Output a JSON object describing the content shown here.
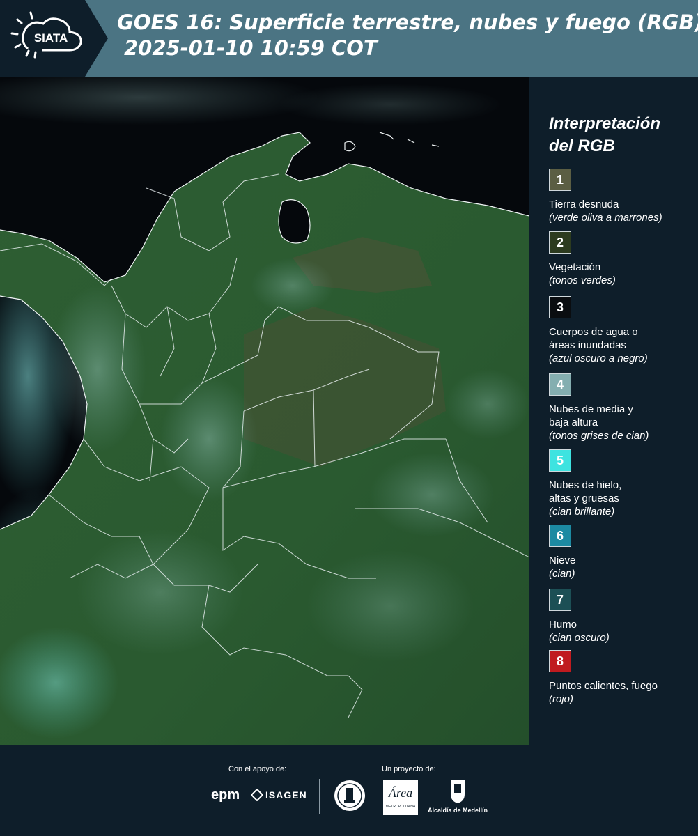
{
  "header": {
    "logo_text": "SIATA",
    "title_line1": "GOES 16: Superficie terrestre, nubes y fuego (RGB)",
    "title_line2": "2025-01-10 10:59 COT"
  },
  "legend": {
    "title": "Interpretación del RGB",
    "items": [
      {
        "number": "1",
        "color": "#5b5e43",
        "label": "Tierra desnuda",
        "note": "(verde oliva a marrones)"
      },
      {
        "number": "2",
        "color": "#2c3b1f",
        "label": "Vegetación",
        "note": "(tonos verdes)"
      },
      {
        "number": "3",
        "color": "#0a0d10",
        "label": "Cuerpos de agua o áreas inundadas",
        "note": "(azul oscuro a negro)"
      },
      {
        "number": "4",
        "color": "#84aeb0",
        "label": "Nubes de media y baja altura",
        "note": "(tonos grises de cian)"
      },
      {
        "number": "5",
        "color": "#3ee3e0",
        "label": "Nubes de hielo, altas y gruesas",
        "note": "(cian brillante)"
      },
      {
        "number": "6",
        "color": "#1c8aa2",
        "label": "Nieve",
        "note": "(cian)"
      },
      {
        "number": "7",
        "color": "#1c4f55",
        "label": "Humo",
        "note": "(cian oscuro)"
      },
      {
        "number": "8",
        "color": "#c01b1f",
        "label": "Puntos calientes, fuego",
        "note": "(rojo)"
      }
    ]
  },
  "footer": {
    "support_label": "Con el apoyo de:",
    "project_label": "Un proyecto de:",
    "epm_logo": "epm",
    "isagen_logo": "ISAGEN",
    "area_logo": "Área",
    "area_sub": "METROPOLITANA",
    "medellin_logo": "Alcaldía de Medellín"
  },
  "colors": {
    "header_bg": "#4b7483",
    "page_bg": "#0e1e2a",
    "ocean": "#05080c",
    "land": "#2f5f33"
  }
}
